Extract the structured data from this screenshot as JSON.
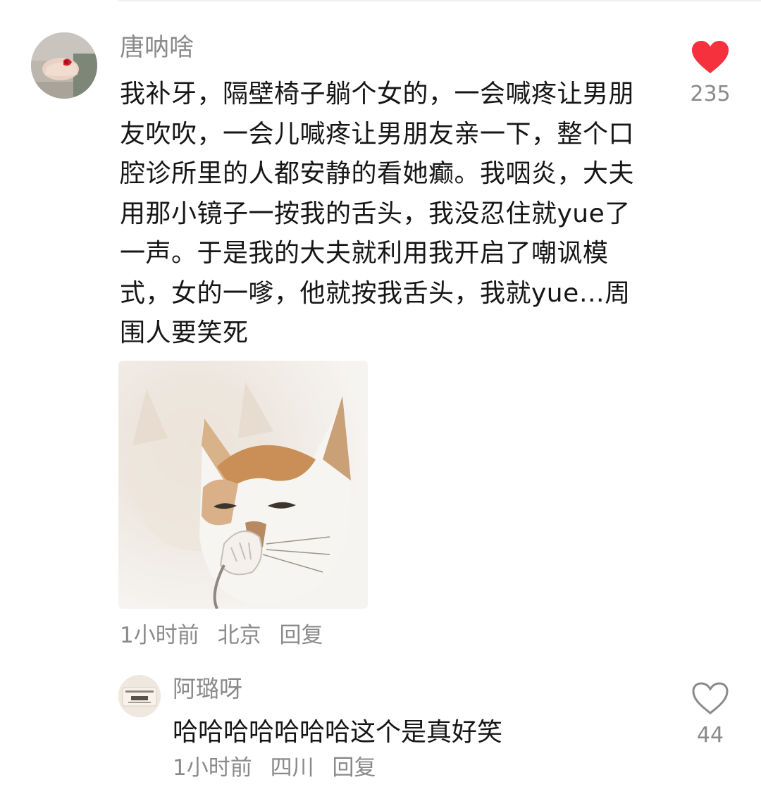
{
  "main_comment": {
    "username": "唐呐啥",
    "text": "我补牙，隔壁椅子躺个女的，一会喊疼让男朋友吹吹，一会儿喊疼让男朋友亲一下，整个口腔诊所里的人都安静的看她癫。我咽炎，大夫用那小镜子一按我的舌头，我没忍住就yue了一声。于是我的大夫就利用我开启了嘲讽模式，女的一嗲，他就按我舌头，我就yue…周围人要笑死",
    "time": "1小时前",
    "location": "北京",
    "reply_label": "回复",
    "likes": "235",
    "liked": true,
    "like_color": "#f5313d"
  },
  "reply": {
    "username": "阿璐呀",
    "text": "哈哈哈哈哈哈哈这个是真好笑",
    "time": "1小时前",
    "location": "四川",
    "reply_label": "回复",
    "likes": "44",
    "liked": false
  },
  "icons": {
    "like_filled": "heart-filled-icon",
    "like_outline": "heart-outline-icon"
  },
  "colors": {
    "secondary_text": "#8a8a8a",
    "primary_text": "#161616",
    "background": "#ffffff"
  }
}
